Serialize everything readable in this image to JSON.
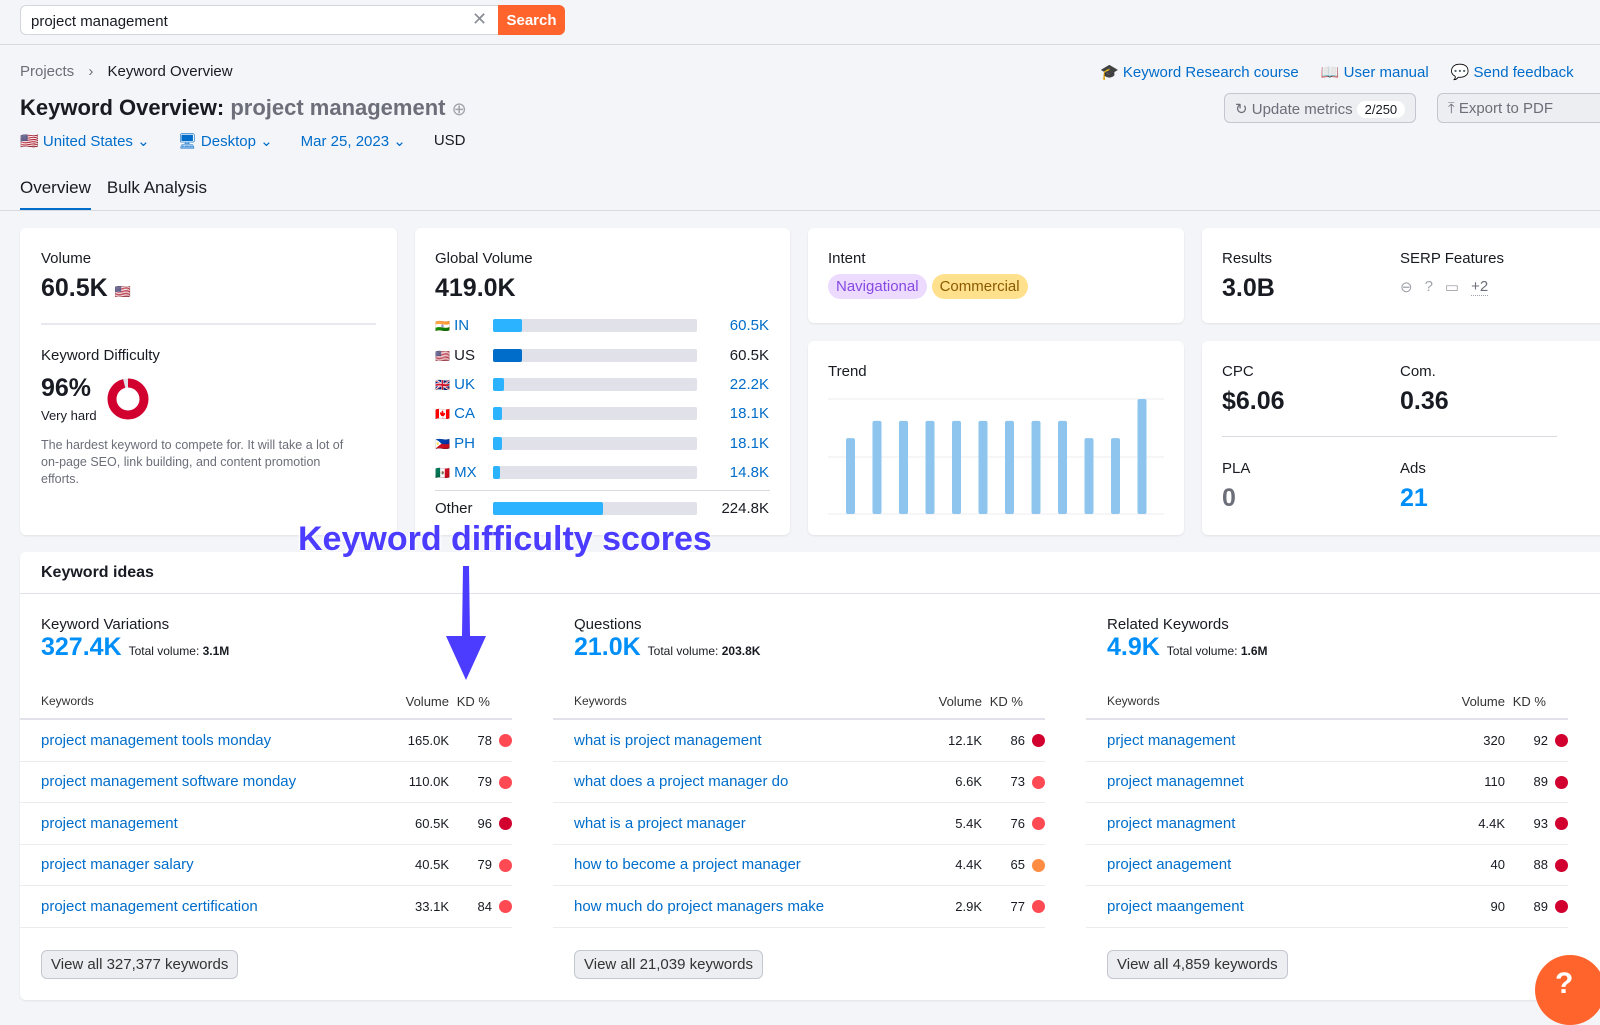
{
  "search": {
    "value": "project management",
    "button": "Search"
  },
  "breadcrumb": [
    "Projects",
    "Keyword Overview"
  ],
  "title": {
    "label": "Keyword Overview:",
    "keyword": "project management"
  },
  "filters": {
    "country": "United States",
    "device": "Desktop",
    "date": "Mar 25, 2023",
    "currency": "USD"
  },
  "tabs": [
    "Overview",
    "Bulk Analysis"
  ],
  "links": [
    "Keyword Research course",
    "User manual",
    "Send feedback"
  ],
  "actions": {
    "update": "Update metrics",
    "update_count": "2/250",
    "export": "Export to PDF"
  },
  "volume": {
    "label": "Volume",
    "value": "60.5K"
  },
  "kd": {
    "label": "Keyword Difficulty",
    "value": "96%",
    "percent": 96,
    "level": "Very hard",
    "desc": "The hardest keyword to compete for. It will take a lot of on-page SEO, link building, and content promotion efforts.",
    "color": "#d1002f"
  },
  "global": {
    "label": "Global Volume",
    "value": "419.0K",
    "rows": [
      {
        "c": "IN",
        "v": "60.5K",
        "share": 14.4
      },
      {
        "c": "US",
        "v": "60.5K",
        "share": 14.4
      },
      {
        "c": "UK",
        "v": "22.2K",
        "share": 5.3
      },
      {
        "c": "CA",
        "v": "18.1K",
        "share": 4.3
      },
      {
        "c": "PH",
        "v": "18.1K",
        "share": 4.3
      },
      {
        "c": "MX",
        "v": "14.8K",
        "share": 3.5
      }
    ],
    "other": {
      "c": "Other",
      "v": "224.8K",
      "share": 53.7
    }
  },
  "intent": {
    "label": "Intent",
    "badges": [
      "Navigational",
      "Commercial"
    ]
  },
  "trend": {
    "label": "Trend",
    "relative": [
      66,
      81,
      81,
      81,
      81,
      81,
      81,
      81,
      81,
      66,
      66,
      100
    ]
  },
  "results": {
    "label": "Results",
    "value": "3.0B"
  },
  "serp": {
    "label": "SERP Features",
    "more": "+2",
    "icons": [
      "link-icon",
      "question-icon",
      "faq-icon"
    ]
  },
  "cpc": {
    "label": "CPC",
    "value": "$6.06"
  },
  "com": {
    "label": "Com.",
    "value": "0.36"
  },
  "pla": {
    "label": "PLA",
    "value": "0"
  },
  "ads": {
    "label": "Ads",
    "value": "21"
  },
  "ideas": {
    "title": "Keyword ideas",
    "cols": {
      "k": "Keywords",
      "v": "Volume",
      "kd": "KD %"
    },
    "groups": [
      {
        "title": "Keyword Variations",
        "num": "327.4K",
        "tv_label": "Total volume:",
        "tv": "3.1M",
        "view": "View all 327,377 keywords",
        "rows": [
          {
            "k": "project management tools monday",
            "v": "165.0K",
            "kd": "78"
          },
          {
            "k": "project management software monday",
            "v": "110.0K",
            "kd": "79"
          },
          {
            "k": "project management",
            "v": "60.5K",
            "kd": "96"
          },
          {
            "k": "project manager salary",
            "v": "40.5K",
            "kd": "79"
          },
          {
            "k": "project management certification",
            "v": "33.1K",
            "kd": "84"
          }
        ]
      },
      {
        "title": "Questions",
        "num": "21.0K",
        "tv_label": "Total volume:",
        "tv": "203.8K",
        "view": "View all 21,039 keywords",
        "rows": [
          {
            "k": "what is project management",
            "v": "12.1K",
            "kd": "86"
          },
          {
            "k": "what does a project manager do",
            "v": "6.6K",
            "kd": "73"
          },
          {
            "k": "what is a project manager",
            "v": "5.4K",
            "kd": "76"
          },
          {
            "k": "how to become a project manager",
            "v": "4.4K",
            "kd": "65"
          },
          {
            "k": "how much do project managers make",
            "v": "2.9K",
            "kd": "77"
          }
        ]
      },
      {
        "title": "Related Keywords",
        "num": "4.9K",
        "tv_label": "Total volume:",
        "tv": "1.6M",
        "view": "View all 4,859 keywords",
        "rows": [
          {
            "k": "prject management",
            "v": "320",
            "kd": "92"
          },
          {
            "k": "project managemnet",
            "v": "110",
            "kd": "89"
          },
          {
            "k": "project managment",
            "v": "4.4K",
            "kd": "93"
          },
          {
            "k": "project anagement",
            "v": "40",
            "kd": "88"
          },
          {
            "k": "project maangement",
            "v": "90",
            "kd": "89"
          }
        ]
      }
    ]
  },
  "annotation": "Keyword difficulty scores",
  "colors": {
    "accent": "#006dca",
    "search_button": "#ff642d",
    "kd_very_hard": "#d1002f",
    "kd_hard": "#ff4953",
    "kd_difficult": "#ff8c43",
    "trend_bar": "#8ec5ee",
    "annotation": "#4b3cff"
  }
}
